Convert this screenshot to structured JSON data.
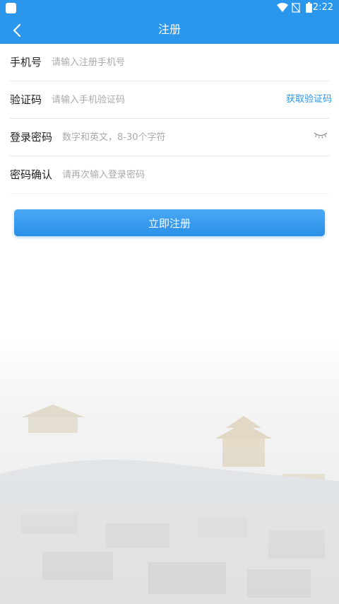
{
  "status_bar": {
    "time": "2:22",
    "icons": [
      "app-icon",
      "wifi-icon",
      "no-signal-icon",
      "battery-icon"
    ]
  },
  "app_bar": {
    "title": "注册",
    "back_icon": "chevron-left-icon"
  },
  "form": {
    "phone": {
      "label": "手机号",
      "placeholder": "请输入注册手机号"
    },
    "code": {
      "label": "验证码",
      "placeholder": "请输入手机验证码",
      "action": "获取验证码"
    },
    "password": {
      "label": "登录密码",
      "placeholder": "数字和英文，8-30个字符",
      "toggle_icon": "eye-closed-icon"
    },
    "confirm": {
      "label": "密码确认",
      "placeholder": "请再次输入登录密码"
    }
  },
  "submit_label": "立即注册",
  "colors": {
    "primary": "#2a96ec",
    "link": "#2a96ec",
    "placeholder": "#aaaaaa",
    "text": "#222222"
  }
}
